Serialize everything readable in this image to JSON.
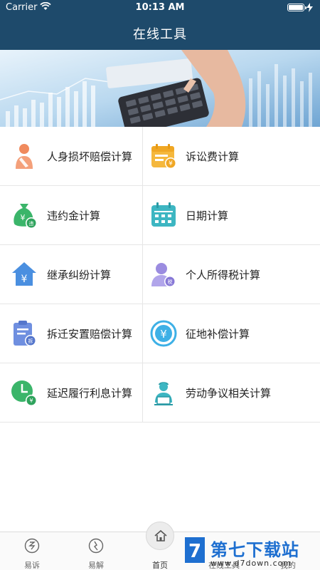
{
  "status": {
    "carrier": "Carrier",
    "time": "10:13 AM"
  },
  "header": {
    "title": "在线工具"
  },
  "tools": [
    {
      "label": "人身损坏赔偿计算",
      "icon": "injury-person-icon"
    },
    {
      "label": "诉讼费计算",
      "icon": "calendar-yuan-icon"
    },
    {
      "label": "违约金计算",
      "icon": "money-bag-icon"
    },
    {
      "label": "日期计算",
      "icon": "calendar-icon"
    },
    {
      "label": "继承纠纷计算",
      "icon": "house-yuan-icon"
    },
    {
      "label": "个人所得税计算",
      "icon": "person-tax-icon"
    },
    {
      "label": "拆迁安置赔偿计算",
      "icon": "clipboard-demolish-icon"
    },
    {
      "label": "征地补偿计算",
      "icon": "yuan-circle-icon"
    },
    {
      "label": "延迟履行利息计算",
      "icon": "clock-yuan-icon"
    },
    {
      "label": "劳动争议相关计算",
      "icon": "worker-laptop-icon"
    }
  ],
  "tabbar": {
    "tabs": [
      {
        "label": "易诉"
      },
      {
        "label": "易解"
      },
      {
        "label": "首页"
      },
      {
        "label": "在线工具"
      },
      {
        "label": "我的"
      }
    ]
  },
  "watermark": {
    "title": "第七下载站",
    "url": "www.d7down.com",
    "logo_letter": "7"
  },
  "colors": {
    "nav": "#1e4a6b",
    "orange": "#f08a5d",
    "yellow": "#f5b83d",
    "green": "#3bb56a",
    "teal": "#3db6c2",
    "blue": "#4a8fe0",
    "purple": "#9b8ce0"
  }
}
